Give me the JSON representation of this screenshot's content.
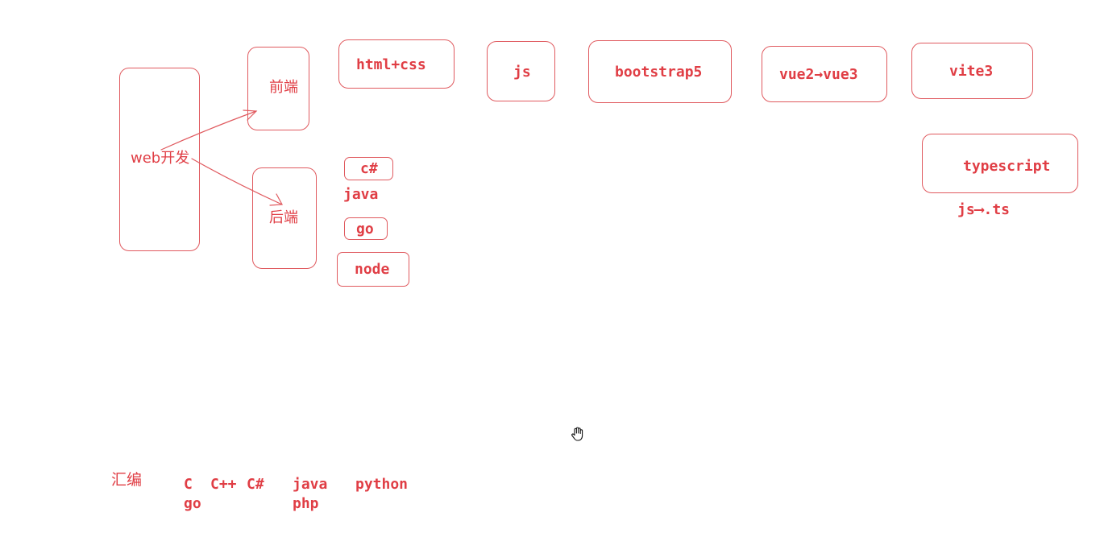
{
  "colors": {
    "ink": "#e03e45",
    "stroke": "#e05a5f",
    "background": "#ffffff"
  },
  "root": {
    "label": "web开发"
  },
  "frontend": {
    "label": "前端",
    "stack": [
      "html+css",
      "js",
      "bootstrap5",
      "vue2→vue3",
      "vite3"
    ],
    "typescript": {
      "label": "typescript",
      "note": "js⟶.ts"
    }
  },
  "backend": {
    "label": "后端",
    "languages": [
      "c#",
      "java",
      "go",
      "node"
    ]
  },
  "languages_row": {
    "label": "汇编",
    "line1": [
      "C",
      "C++",
      "C#",
      "java",
      "python"
    ],
    "line2": [
      "go",
      "php"
    ]
  },
  "cursor": {
    "icon": "hand-cursor-icon"
  }
}
